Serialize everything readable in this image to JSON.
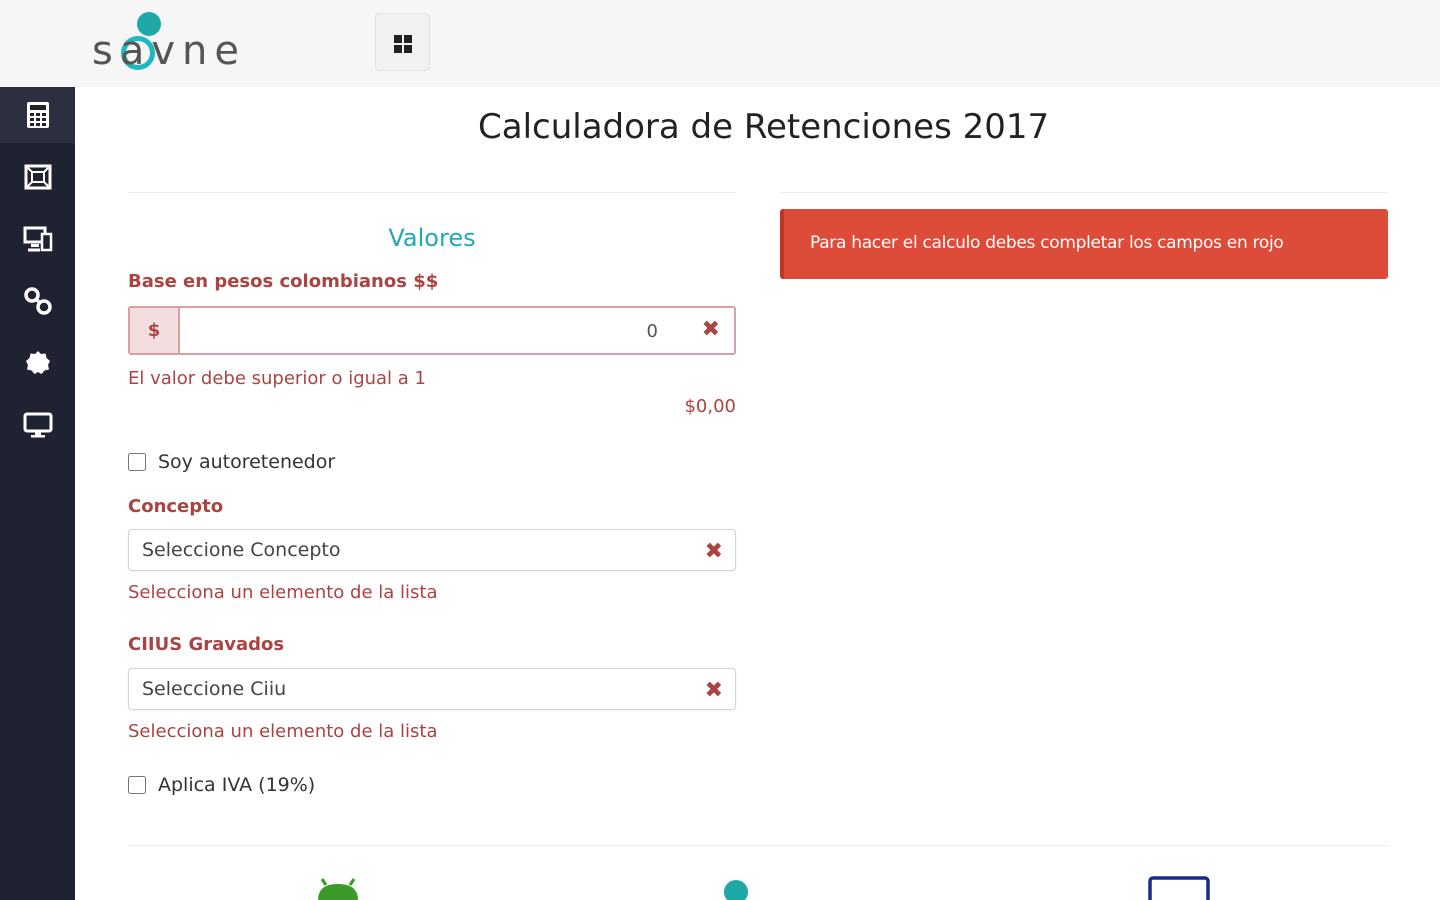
{
  "header": {
    "logo_text": "savne"
  },
  "sidebar": {
    "items": [
      {
        "icon": "calculator-icon"
      },
      {
        "icon": "frame-icon"
      },
      {
        "icon": "devices-icon"
      },
      {
        "icon": "link-icon"
      },
      {
        "icon": "badge-icon"
      },
      {
        "icon": "monitor-icon"
      }
    ]
  },
  "main": {
    "title": "Calculadora de Retenciones 2017",
    "section_title": "Valores",
    "base": {
      "label": "Base en pesos colombianos $$",
      "addon": "$",
      "value": "0",
      "error": "El valor debe superior o igual a 1",
      "formatted": "$0,00"
    },
    "autoretenedor_label": "Soy autoretenedor",
    "concepto": {
      "label": "Concepto",
      "placeholder": "Seleccione Concepto",
      "error": "Selecciona un elemento de la lista"
    },
    "ciius": {
      "label": "CIIUS Gravados",
      "placeholder": "Seleccione Ciiu",
      "error": "Selecciona un elemento de la lista"
    },
    "iva_label": "Aplica IVA (19%)",
    "alert_text": "Para hacer el calculo debes completar los campos en rojo"
  },
  "colors": {
    "accent": "#24a9b4",
    "error": "#a94442",
    "alert_bg": "#dd4b39",
    "sidebar_bg": "#1f2230"
  }
}
